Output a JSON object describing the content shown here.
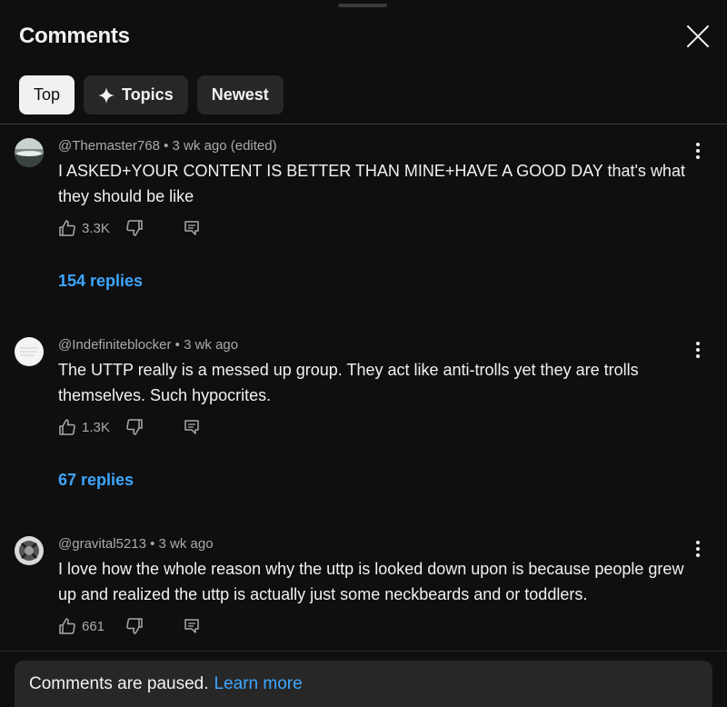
{
  "header": {
    "title": "Comments",
    "close_icon": "close-icon"
  },
  "chips": [
    {
      "label": "Top",
      "active": true
    },
    {
      "label": "Topics",
      "icon": "sparkle-icon",
      "active": false
    },
    {
      "label": "Newest",
      "active": false
    }
  ],
  "comments": [
    {
      "author": "@Themaster768",
      "time": "3 wk ago (edited)",
      "text": "I ASKED+YOUR CONTENT IS BETTER THAN MINE+HAVE A GOOD DAY that's what they should be like",
      "likes": "3.3K",
      "replies": "154 replies"
    },
    {
      "author": "@Indefiniteblocker",
      "time": "3 wk ago",
      "text": "The UTTP really is a messed up group. They act like anti-trolls yet they are trolls themselves. Such hypocrites.",
      "likes": "1.3K",
      "replies": "67 replies"
    },
    {
      "author": "@gravital5213",
      "time": "3 wk ago",
      "text": "I love how the whole reason why the uttp is looked down upon is because people grew up and realized the uttp is actually just some neckbeards and or toddlers.",
      "likes": "661"
    }
  ],
  "footer": {
    "paused_text": "Comments are paused.",
    "learn_more": "Learn more"
  },
  "colors": {
    "background": "#0f0f0f",
    "chip_bg": "#272727",
    "link_blue": "#3ea6ff",
    "secondary_text": "#aaaaaa"
  }
}
